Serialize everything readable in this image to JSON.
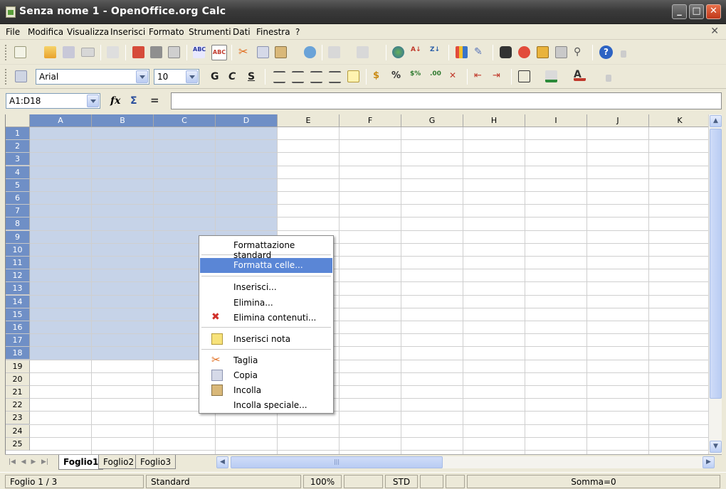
{
  "window": {
    "title": "Senza nome 1 - OpenOffice.org Calc"
  },
  "menu": [
    "File",
    "Modifica",
    "Visualizza",
    "Inserisci",
    "Formato",
    "Strumenti",
    "Dati",
    "Finestra",
    "?"
  ],
  "format_toolbar": {
    "font_name": "Arial",
    "font_size": "10",
    "bold": "G",
    "italic": "C",
    "underline": "S"
  },
  "formula_bar": {
    "name_box": "A1:D18",
    "input_value": ""
  },
  "grid": {
    "columns": [
      "A",
      "B",
      "C",
      "D",
      "E",
      "F",
      "G",
      "H",
      "I",
      "J",
      "K"
    ],
    "rows": [
      "1",
      "2",
      "3",
      "4",
      "5",
      "6",
      "7",
      "8",
      "9",
      "10",
      "11",
      "12",
      "13",
      "14",
      "15",
      "16",
      "17",
      "18",
      "19",
      "20",
      "21",
      "22",
      "23",
      "24",
      "25"
    ],
    "selected_range": "A1:D18",
    "selection_color": "#c6d3e8",
    "header_highlight_color": "#6f8fc6"
  },
  "context_menu": {
    "items": [
      {
        "label": "Formattazione standard",
        "icon": ""
      },
      {
        "label": "Formatta celle...",
        "icon": "",
        "highlighted": true
      },
      {
        "label": "Inserisci...",
        "icon": ""
      },
      {
        "label": "Elimina...",
        "icon": ""
      },
      {
        "label": "Elimina contenuti...",
        "icon": "red-x-icon"
      },
      {
        "label": "Inserisci nota",
        "icon": "note-icon"
      },
      {
        "label": "Taglia",
        "icon": "scissors-icon"
      },
      {
        "label": "Copia",
        "icon": "copy-icon"
      },
      {
        "label": "Incolla",
        "icon": "paste-icon"
      },
      {
        "label": "Incolla speciale...",
        "icon": ""
      }
    ],
    "highlight_color": "#5a86d6"
  },
  "sheets": {
    "tabs": [
      "Foglio1",
      "Foglio2",
      "Foglio3"
    ],
    "active": "Foglio1"
  },
  "status": {
    "sheet": "Foglio 1 / 3",
    "style": "Standard",
    "zoom": "100%",
    "mode": "STD",
    "sum": "Somma=0"
  }
}
